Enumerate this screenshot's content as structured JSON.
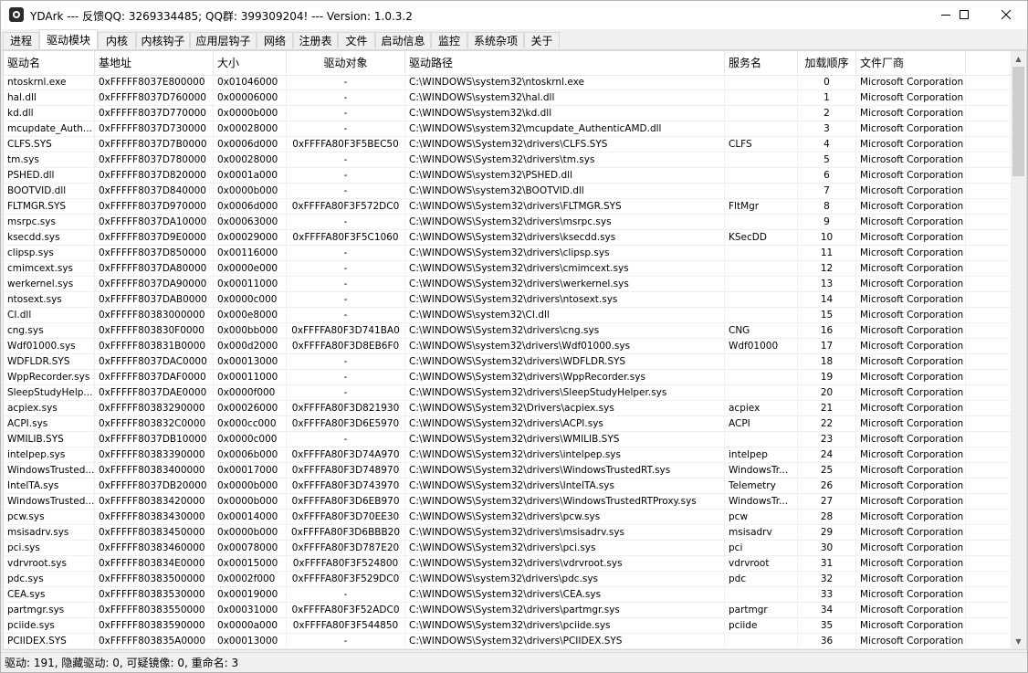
{
  "window": {
    "title": "YDArk --- 反馈QQ: 3269334485; QQ群: 399309204! --- Version: 1.0.3.2",
    "minimize_icon": "minimize-icon",
    "maximize_icon": "maximize-icon",
    "close_icon": "close-icon"
  },
  "tabs": [
    {
      "label": "进程"
    },
    {
      "label": "驱动模块",
      "active": true
    },
    {
      "label": "内核"
    },
    {
      "label": "内核钩子"
    },
    {
      "label": "应用层钩子"
    },
    {
      "label": "网络"
    },
    {
      "label": "注册表"
    },
    {
      "label": "文件"
    },
    {
      "label": "启动信息"
    },
    {
      "label": "监控"
    },
    {
      "label": "系统杂项"
    },
    {
      "label": "关于"
    }
  ],
  "table": {
    "columns": [
      "驱动名",
      "基地址",
      "大小",
      "驱动对象",
      "驱动路径",
      "服务名",
      "加载顺序",
      "文件厂商"
    ],
    "rows": [
      [
        "ntoskrnl.exe",
        "0xFFFFF8037E800000",
        "0x01046000",
        "-",
        "C:\\WINDOWS\\system32\\ntoskrnl.exe",
        "",
        "0",
        "Microsoft Corporation"
      ],
      [
        "hal.dll",
        "0xFFFFF8037D760000",
        "0x00006000",
        "-",
        "C:\\WINDOWS\\system32\\hal.dll",
        "",
        "1",
        "Microsoft Corporation"
      ],
      [
        "kd.dll",
        "0xFFFFF8037D770000",
        "0x0000b000",
        "-",
        "C:\\WINDOWS\\system32\\kd.dll",
        "",
        "2",
        "Microsoft Corporation"
      ],
      [
        "mcupdate_Auth...",
        "0xFFFFF8037D730000",
        "0x00028000",
        "-",
        "C:\\WINDOWS\\system32\\mcupdate_AuthenticAMD.dll",
        "",
        "3",
        "Microsoft Corporation"
      ],
      [
        "CLFS.SYS",
        "0xFFFFF8037D7B0000",
        "0x0006d000",
        "0xFFFFA80F3F5BEC50",
        "C:\\WINDOWS\\System32\\drivers\\CLFS.SYS",
        "CLFS",
        "4",
        "Microsoft Corporation"
      ],
      [
        "tm.sys",
        "0xFFFFF8037D780000",
        "0x00028000",
        "-",
        "C:\\WINDOWS\\System32\\drivers\\tm.sys",
        "",
        "5",
        "Microsoft Corporation"
      ],
      [
        "PSHED.dll",
        "0xFFFFF8037D820000",
        "0x0001a000",
        "-",
        "C:\\WINDOWS\\system32\\PSHED.dll",
        "",
        "6",
        "Microsoft Corporation"
      ],
      [
        "BOOTVID.dll",
        "0xFFFFF8037D840000",
        "0x0000b000",
        "-",
        "C:\\WINDOWS\\system32\\BOOTVID.dll",
        "",
        "7",
        "Microsoft Corporation"
      ],
      [
        "FLTMGR.SYS",
        "0xFFFFF8037D970000",
        "0x0006d000",
        "0xFFFFA80F3F572DC0",
        "C:\\WINDOWS\\System32\\drivers\\FLTMGR.SYS",
        "FltMgr",
        "8",
        "Microsoft Corporation"
      ],
      [
        "msrpc.sys",
        "0xFFFFF8037DA10000",
        "0x00063000",
        "-",
        "C:\\WINDOWS\\System32\\drivers\\msrpc.sys",
        "",
        "9",
        "Microsoft Corporation"
      ],
      [
        "ksecdd.sys",
        "0xFFFFF8037D9E0000",
        "0x00029000",
        "0xFFFFA80F3F5C1060",
        "C:\\WINDOWS\\System32\\drivers\\ksecdd.sys",
        "KSecDD",
        "10",
        "Microsoft Corporation"
      ],
      [
        "clipsp.sys",
        "0xFFFFF8037D850000",
        "0x00116000",
        "-",
        "C:\\WINDOWS\\System32\\drivers\\clipsp.sys",
        "",
        "11",
        "Microsoft Corporation"
      ],
      [
        "cmimcext.sys",
        "0xFFFFF8037DA80000",
        "0x0000e000",
        "-",
        "C:\\WINDOWS\\System32\\drivers\\cmimcext.sys",
        "",
        "12",
        "Microsoft Corporation"
      ],
      [
        "werkernel.sys",
        "0xFFFFF8037DA90000",
        "0x00011000",
        "-",
        "C:\\WINDOWS\\System32\\drivers\\werkernel.sys",
        "",
        "13",
        "Microsoft Corporation"
      ],
      [
        "ntosext.sys",
        "0xFFFFF8037DAB0000",
        "0x0000c000",
        "-",
        "C:\\WINDOWS\\System32\\drivers\\ntosext.sys",
        "",
        "14",
        "Microsoft Corporation"
      ],
      [
        "CI.dll",
        "0xFFFFF80383000000",
        "0x000e8000",
        "-",
        "C:\\WINDOWS\\system32\\CI.dll",
        "",
        "15",
        "Microsoft Corporation"
      ],
      [
        "cng.sys",
        "0xFFFFF803830F0000",
        "0x000bb000",
        "0xFFFFA80F3D741BA0",
        "C:\\WINDOWS\\System32\\drivers\\cng.sys",
        "CNG",
        "16",
        "Microsoft Corporation"
      ],
      [
        "Wdf01000.sys",
        "0xFFFFF803831B0000",
        "0x000d2000",
        "0xFFFFA80F3D8EB6F0",
        "C:\\WINDOWS\\system32\\drivers\\Wdf01000.sys",
        "Wdf01000",
        "17",
        "Microsoft Corporation"
      ],
      [
        "WDFLDR.SYS",
        "0xFFFFF8037DAC0000",
        "0x00013000",
        "-",
        "C:\\WINDOWS\\System32\\drivers\\WDFLDR.SYS",
        "",
        "18",
        "Microsoft Corporation"
      ],
      [
        "WppRecorder.sys",
        "0xFFFFF8037DAF0000",
        "0x00011000",
        "-",
        "C:\\WINDOWS\\System32\\drivers\\WppRecorder.sys",
        "",
        "19",
        "Microsoft Corporation"
      ],
      [
        "SleepStudyHelp...",
        "0xFFFFF8037DAE0000",
        "0x0000f000",
        "-",
        "C:\\WINDOWS\\System32\\drivers\\SleepStudyHelper.sys",
        "",
        "20",
        "Microsoft Corporation"
      ],
      [
        "acpiex.sys",
        "0xFFFFF80383290000",
        "0x00026000",
        "0xFFFFA80F3D821930",
        "C:\\WINDOWS\\System32\\Drivers\\acpiex.sys",
        "acpiex",
        "21",
        "Microsoft Corporation"
      ],
      [
        "ACPI.sys",
        "0xFFFFF803832C0000",
        "0x000cc000",
        "0xFFFFA80F3D6E5970",
        "C:\\WINDOWS\\System32\\drivers\\ACPI.sys",
        "ACPI",
        "22",
        "Microsoft Corporation"
      ],
      [
        "WMILIB.SYS",
        "0xFFFFF8037DB10000",
        "0x0000c000",
        "-",
        "C:\\WINDOWS\\System32\\drivers\\WMILIB.SYS",
        "",
        "23",
        "Microsoft Corporation"
      ],
      [
        "intelpep.sys",
        "0xFFFFF80383390000",
        "0x0006b000",
        "0xFFFFA80F3D74A970",
        "C:\\WINDOWS\\System32\\drivers\\intelpep.sys",
        "intelpep",
        "24",
        "Microsoft Corporation"
      ],
      [
        "WindowsTrusted...",
        "0xFFFFF80383400000",
        "0x00017000",
        "0xFFFFA80F3D748970",
        "C:\\WINDOWS\\System32\\drivers\\WindowsTrustedRT.sys",
        "WindowsTr...",
        "25",
        "Microsoft Corporation"
      ],
      [
        "IntelTA.sys",
        "0xFFFFF8037DB20000",
        "0x0000b000",
        "0xFFFFA80F3D743970",
        "C:\\WINDOWS\\System32\\drivers\\IntelTA.sys",
        "Telemetry",
        "26",
        "Microsoft Corporation"
      ],
      [
        "WindowsTrusted...",
        "0xFFFFF80383420000",
        "0x0000b000",
        "0xFFFFA80F3D6EB970",
        "C:\\WINDOWS\\System32\\drivers\\WindowsTrustedRTProxy.sys",
        "WindowsTr...",
        "27",
        "Microsoft Corporation"
      ],
      [
        "pcw.sys",
        "0xFFFFF80383430000",
        "0x00014000",
        "0xFFFFA80F3D70EE30",
        "C:\\WINDOWS\\System32\\drivers\\pcw.sys",
        "pcw",
        "28",
        "Microsoft Corporation"
      ],
      [
        "msisadrv.sys",
        "0xFFFFF80383450000",
        "0x0000b000",
        "0xFFFFA80F3D6BBB20",
        "C:\\WINDOWS\\System32\\drivers\\msisadrv.sys",
        "msisadrv",
        "29",
        "Microsoft Corporation"
      ],
      [
        "pci.sys",
        "0xFFFFF80383460000",
        "0x00078000",
        "0xFFFFA80F3D787E20",
        "C:\\WINDOWS\\System32\\drivers\\pci.sys",
        "pci",
        "30",
        "Microsoft Corporation"
      ],
      [
        "vdrvroot.sys",
        "0xFFFFF803834E0000",
        "0x00015000",
        "0xFFFFA80F3F524800",
        "C:\\WINDOWS\\System32\\drivers\\vdrvroot.sys",
        "vdrvroot",
        "31",
        "Microsoft Corporation"
      ],
      [
        "pdc.sys",
        "0xFFFFF80383500000",
        "0x0002f000",
        "0xFFFFA80F3F529DC0",
        "C:\\WINDOWS\\system32\\drivers\\pdc.sys",
        "pdc",
        "32",
        "Microsoft Corporation"
      ],
      [
        "CEA.sys",
        "0xFFFFF80383530000",
        "0x00019000",
        "-",
        "C:\\WINDOWS\\System32\\drivers\\CEA.sys",
        "",
        "33",
        "Microsoft Corporation"
      ],
      [
        "partmgr.sys",
        "0xFFFFF80383550000",
        "0x00031000",
        "0xFFFFA80F3F52ADC0",
        "C:\\WINDOWS\\System32\\drivers\\partmgr.sys",
        "partmgr",
        "34",
        "Microsoft Corporation"
      ],
      [
        "pciide.sys",
        "0xFFFFF80383590000",
        "0x0000a000",
        "0xFFFFA80F3F544850",
        "C:\\WINDOWS\\System32\\drivers\\pciide.sys",
        "pciide",
        "35",
        "Microsoft Corporation"
      ],
      [
        "PCIIDEX.SYS",
        "0xFFFFF803835A0000",
        "0x00013000",
        "-",
        "C:\\WINDOWS\\System32\\drivers\\PCIIDEX.SYS",
        "",
        "36",
        "Microsoft Corporation"
      ]
    ]
  },
  "status": {
    "text": "驱动: 191, 隐藏驱动: 0, 可疑镜像: 0, 重命名: 3"
  }
}
